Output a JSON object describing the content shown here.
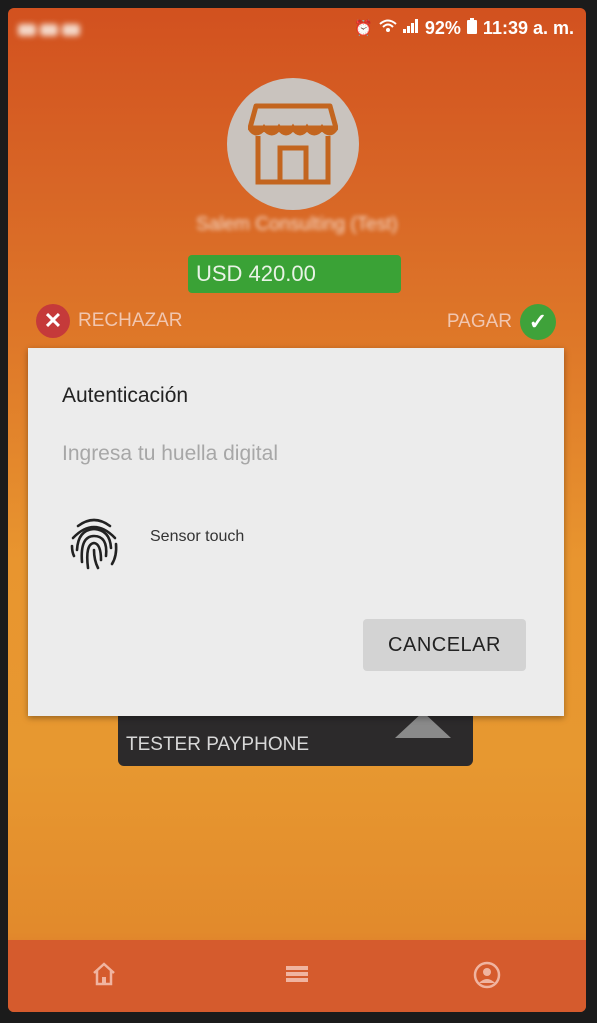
{
  "status_bar": {
    "battery": "92%",
    "time": "11:39 a. m."
  },
  "merchant": {
    "name": "Salem Consulting (Test)",
    "amount": "USD 420.00"
  },
  "actions": {
    "reject_label": "RECHAZAR",
    "pay_label": "PAGAR"
  },
  "card": {
    "holder": "TESTER PAYPHONE"
  },
  "dialog": {
    "title": "Autenticación",
    "subtitle": "Ingresa tu huella digital",
    "sensor_label": "Sensor touch",
    "cancel_label": "CANCELAR"
  },
  "nav": {
    "items": [
      "home-icon",
      "list-icon",
      "profile-icon"
    ]
  },
  "colors": {
    "accent": "#e0782a",
    "success": "#3aa236",
    "danger": "#c53a3a"
  }
}
